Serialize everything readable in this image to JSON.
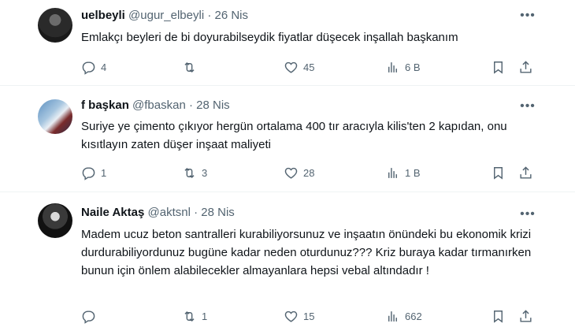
{
  "tweets": [
    {
      "name": "uelbeyli",
      "handle": "@ugur_elbeyli",
      "sep": "·",
      "date": "26 Nis",
      "text": "Emlakçı beyleri de bi doyurabilseydik fiyatlar düşecek inşallah başkanım",
      "replies": "4",
      "retweets": "",
      "likes": "45",
      "views": "6 B"
    },
    {
      "name": "f başkan",
      "handle": "@fbaskan",
      "sep": "·",
      "date": "28 Nis",
      "text": "Suriye ye çimento çıkıyor hergün ortalama 400 tır aracıyla kilis'ten 2 kapıdan, onu kısıtlayın zaten düşer inşaat maliyeti",
      "replies": "1",
      "retweets": "3",
      "likes": "28",
      "views": "1 B"
    },
    {
      "name": "Naile Aktaş",
      "handle": "@aktsnl",
      "sep": "·",
      "date": "28 Nis",
      "text": "Madem ucuz beton santralleri kurabiliyorsunuz ve inşaatın önündeki bu ekonomik krizi durdurabiliyordunuz bugüne kadar neden oturdunuz??? Kriz buraya kadar tırmanırken bunun için önlem alabilecekler almayanlara hepsi vebal altındadır !",
      "replies": "",
      "retweets": "1",
      "likes": "15",
      "views": "662"
    }
  ],
  "icons": {
    "more": "more-dots-icon",
    "reply": "reply-icon",
    "retweet": "retweet-icon",
    "like": "heart-icon",
    "views": "views-chart-icon",
    "bookmark": "bookmark-icon",
    "share": "share-icon"
  }
}
